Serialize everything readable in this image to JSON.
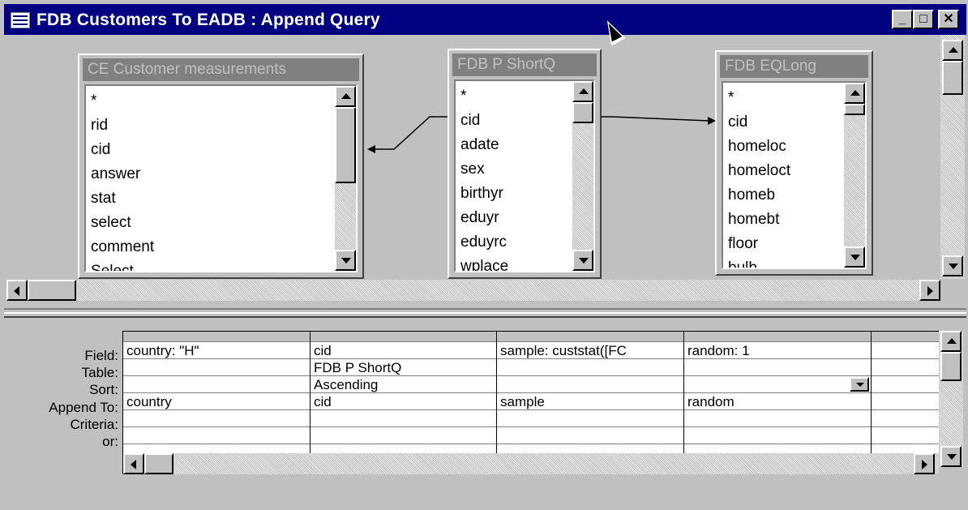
{
  "window": {
    "title": "FDB Customers To EADB : Append Query",
    "buttons": {
      "minimize": "_",
      "maximize": "□",
      "close": "✕"
    }
  },
  "tables": [
    {
      "name": "CE Customer measurements",
      "fields": [
        "*",
        "rid",
        "cid",
        "answer",
        "stat",
        "select",
        "comment",
        "Select"
      ]
    },
    {
      "name": "FDB P ShortQ",
      "fields": [
        "*",
        "cid",
        "adate",
        "sex",
        "birthyr",
        "eduyr",
        "eduyrc",
        "wplace"
      ]
    },
    {
      "name": "FDB EQLong",
      "fields": [
        "*",
        "cid",
        "homeloc",
        "homeloct",
        "homeb",
        "homebt",
        "floor",
        "bulb"
      ]
    }
  ],
  "grid": {
    "row_labels": [
      "Field:",
      "Table:",
      "Sort:",
      "Append To:",
      "Criteria:",
      "or:"
    ],
    "columns": [
      {
        "field": "country: \"H\"",
        "table": "",
        "sort": "",
        "append_to": "country",
        "criteria": "",
        "or": ""
      },
      {
        "field": "cid",
        "table": "FDB P ShortQ",
        "sort": "Ascending",
        "append_to": "cid",
        "criteria": "",
        "or": ""
      },
      {
        "field": "sample: custstat([FC",
        "table": "",
        "sort": "",
        "append_to": "sample",
        "criteria": "",
        "or": ""
      },
      {
        "field": "random: 1",
        "table": "",
        "sort": "",
        "append_to": "random",
        "criteria": "",
        "or": ""
      },
      {
        "field": "",
        "table": "",
        "sort": "",
        "append_to": "",
        "criteria": "",
        "or": ""
      }
    ]
  }
}
